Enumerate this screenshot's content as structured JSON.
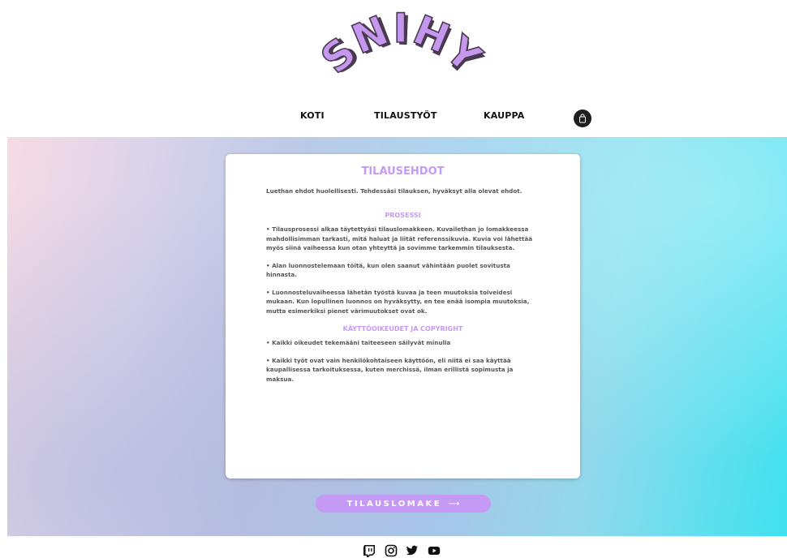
{
  "brand": {
    "logo_text": "SNIHY"
  },
  "nav": {
    "items": [
      {
        "label": "KOTI"
      },
      {
        "label": "TILAUSTYÖT"
      },
      {
        "label": "KAUPPA"
      }
    ],
    "cart_icon": "shopping-bag-icon"
  },
  "card": {
    "title": "TILAUSEHDOT",
    "intro": "Luethan ehdot huolellisesti. Tehdessäsi tilauksen, hyväksyt alla olevat ehdot.",
    "sections": [
      {
        "title": "PROSESSI",
        "paragraphs": [
          "• Tilausprosessi alkaa täytettyäsi tilauslomakkeen. Kuvailethan jo lomakkeessa mahdollisimman tarkasti, mitä haluat ja liität referenssikuvia. Kuvia voi lähettää myös siinä vaiheessa kun otan yhteyttä ja sovimme tarkemmin tilauksesta.",
          "• Alan luonnostelemaan töitä, kun olen saanut vähintään puolet sovitusta hinnasta.",
          "• Luonnosteluvaiheessa lähetän työstä kuvaa ja teen muutoksia toiveidesi mukaan. Kun lopullinen luonnos on hyväksytty, en tee enää isompia muutoksia, mutta esimerkiksi pienet värimuutokset ovat ok."
        ]
      },
      {
        "title": "KÄYTTÖOIKEUDET JA COPYRIGHT",
        "paragraphs": [
          "• Kaikki oikeudet tekemääni taiteeseen säilyvät minulla",
          "• Kaikki työt ovat vain henkilökohtaiseen käyttöön, eli niitä ei saa käyttää kaupallisessa tarkoituksessa, kuten merchissä, ilman erillistä sopimusta ja maksua."
        ]
      }
    ]
  },
  "cta": {
    "label": "TILAUSLOMAKE",
    "arrow": "⟶"
  },
  "footer": {
    "social": [
      "twitch-icon",
      "instagram-icon",
      "twitter-icon",
      "youtube-icon"
    ]
  },
  "colors": {
    "accent": "#c59af4",
    "logo_fill": "#c597ee",
    "logo_shadow": "#4a3a4f"
  }
}
